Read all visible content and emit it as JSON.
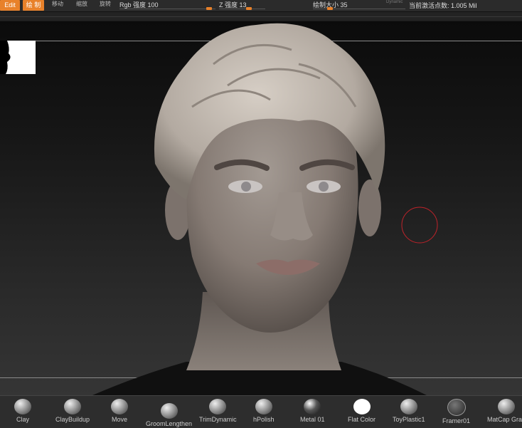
{
  "toolbar": {
    "edit_label": "Edit",
    "draw_label": "绘 制",
    "move_label": "移动",
    "scale_label": "缩放",
    "rotate_label": "旋转",
    "rgb_label": "Rgb 强度 100",
    "rgb_value": 100,
    "z_label": "Z 强度 13",
    "z_value": 13,
    "draw_size_label": "绘制大小 35",
    "draw_size_value": 35,
    "dynamic_label": "Dynamic",
    "status_text": "当前激活点数: 1.005 Mil"
  },
  "brushes": [
    {
      "name": "Clay"
    },
    {
      "name": "ClayBuildup"
    },
    {
      "name": "Move"
    },
    {
      "name": "GroomLengthen"
    },
    {
      "name": "TrimDynamic"
    },
    {
      "name": "hPolish"
    },
    {
      "name": "Metal 01"
    },
    {
      "name": "Flat Color"
    },
    {
      "name": "ToyPlastic1"
    },
    {
      "name": "Framer01"
    },
    {
      "name": "MatCap Gray"
    }
  ],
  "colors": {
    "accent": "#e8812a",
    "brush_cursor": "#c0232a"
  }
}
